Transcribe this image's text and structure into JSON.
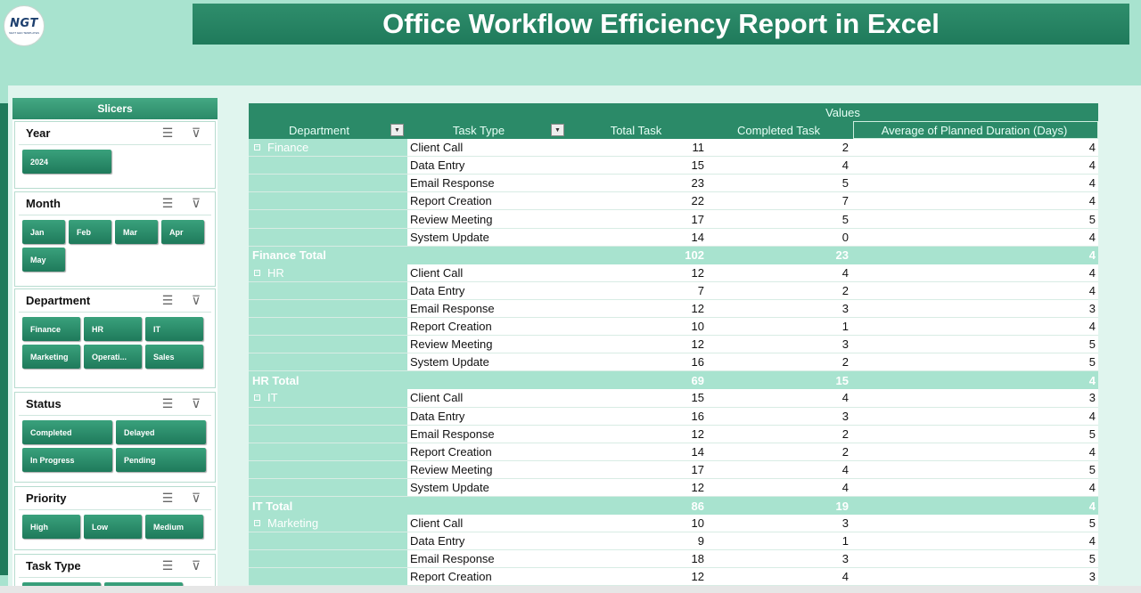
{
  "logo": {
    "text": "NGT",
    "subtext": "NEXT GEN TEMPLATES"
  },
  "title": "Office Workflow Efficiency Report in Excel",
  "slicers": {
    "header": "Slicers",
    "year": {
      "title": "Year",
      "items": [
        "2024"
      ]
    },
    "month": {
      "title": "Month",
      "items": [
        "Jan",
        "Feb",
        "Mar",
        "Apr",
        "May"
      ]
    },
    "department": {
      "title": "Department",
      "items": [
        "Finance",
        "HR",
        "IT",
        "Marketing",
        "Operati...",
        "Sales"
      ]
    },
    "status": {
      "title": "Status",
      "items": [
        "Completed",
        "Delayed",
        "In Progress",
        "Pending"
      ]
    },
    "priority": {
      "title": "Priority",
      "items": [
        "High",
        "Low",
        "Medium"
      ]
    },
    "task_type": {
      "title": "Task Type"
    }
  },
  "pivot": {
    "values_label": "Values",
    "headers": [
      "Department",
      "Task Type",
      "Total Task",
      "Completed Task",
      "Average of Planned Duration (Days)"
    ],
    "groups": [
      {
        "dept": "Finance",
        "rows": [
          [
            "Client Call",
            "11",
            "2",
            "4"
          ],
          [
            "Data Entry",
            "15",
            "4",
            "4"
          ],
          [
            "Email Response",
            "23",
            "5",
            "4"
          ],
          [
            "Report Creation",
            "22",
            "7",
            "4"
          ],
          [
            "Review Meeting",
            "17",
            "5",
            "5"
          ],
          [
            "System Update",
            "14",
            "0",
            "4"
          ]
        ],
        "total": [
          "Finance Total",
          "102",
          "23",
          "4"
        ]
      },
      {
        "dept": "HR",
        "rows": [
          [
            "Client Call",
            "12",
            "4",
            "4"
          ],
          [
            "Data Entry",
            "7",
            "2",
            "4"
          ],
          [
            "Email Response",
            "12",
            "3",
            "3"
          ],
          [
            "Report Creation",
            "10",
            "1",
            "4"
          ],
          [
            "Review Meeting",
            "12",
            "3",
            "5"
          ],
          [
            "System Update",
            "16",
            "2",
            "5"
          ]
        ],
        "total": [
          "HR Total",
          "69",
          "15",
          "4"
        ]
      },
      {
        "dept": "IT",
        "rows": [
          [
            "Client Call",
            "15",
            "4",
            "3"
          ],
          [
            "Data Entry",
            "16",
            "3",
            "4"
          ],
          [
            "Email Response",
            "12",
            "2",
            "5"
          ],
          [
            "Report Creation",
            "14",
            "2",
            "4"
          ],
          [
            "Review Meeting",
            "17",
            "4",
            "5"
          ],
          [
            "System Update",
            "12",
            "4",
            "4"
          ]
        ],
        "total": [
          "IT Total",
          "86",
          "19",
          "4"
        ]
      },
      {
        "dept": "Marketing",
        "rows": [
          [
            "Client Call",
            "10",
            "3",
            "5"
          ],
          [
            "Data Entry",
            "9",
            "1",
            "4"
          ],
          [
            "Email Response",
            "18",
            "3",
            "5"
          ],
          [
            "Report Creation",
            "12",
            "4",
            "3"
          ]
        ]
      }
    ]
  }
}
